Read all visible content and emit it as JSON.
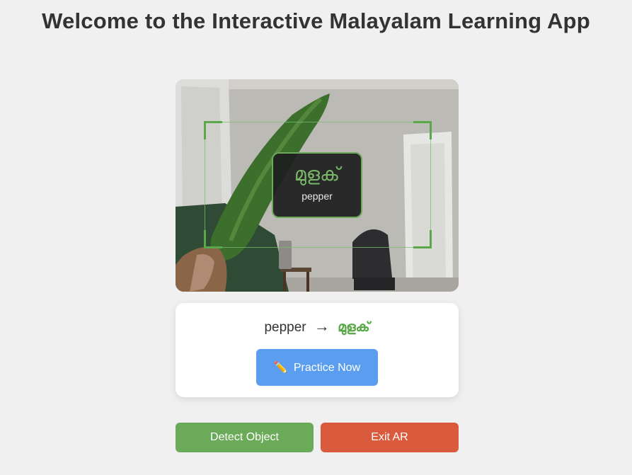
{
  "header": {
    "title": "Welcome to the Interactive Malayalam Learning App"
  },
  "ar_view": {
    "detected_label_malayalam": "മുളക്",
    "detected_label_english": "pepper"
  },
  "translation": {
    "english": "pepper",
    "arrow": "→",
    "malayalam": "മുളക്",
    "practice_icon": "✏️",
    "practice_label": "Practice Now"
  },
  "controls": {
    "detect_label": "Detect Object",
    "exit_label": "Exit AR"
  },
  "colors": {
    "accent_green": "#5aa84a",
    "practice_blue": "#5b9ef0",
    "exit_red": "#d95a3c"
  }
}
